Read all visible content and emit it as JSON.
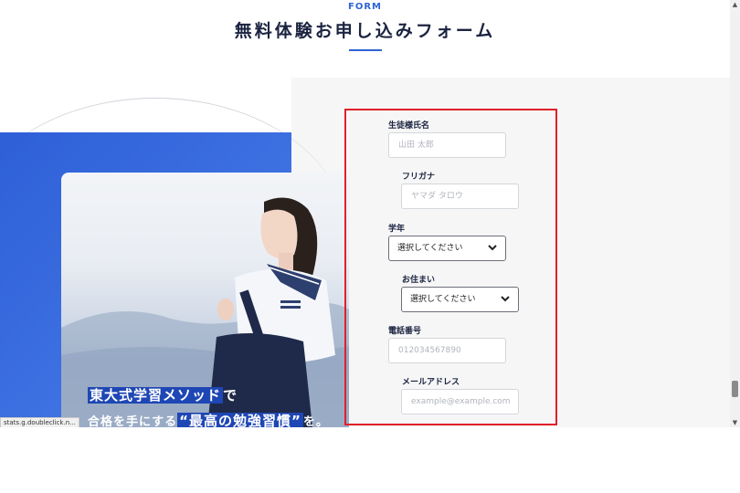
{
  "header": {
    "eyebrow": "FORM",
    "title": "無料体験お申し込みフォーム"
  },
  "hero": {
    "catch_highlight": "東大式学習メソッド",
    "catch_suffix": "で",
    "catch2_prefix": "合格を手にする",
    "catch2_highlight": "“最高の勉強習慣”",
    "catch2_suffix": "を。"
  },
  "form": {
    "student_name": {
      "label": "生徒様氏名",
      "placeholder": "山田 太郎"
    },
    "furigana": {
      "label": "フリガナ",
      "placeholder": "ヤマダ タロウ"
    },
    "grade": {
      "label": "学年",
      "value": "選択してください"
    },
    "residence": {
      "label": "お住まい",
      "value": "選択してください"
    },
    "phone": {
      "label": "電話番号",
      "placeholder": "012034567890"
    },
    "email": {
      "label": "メールアドレス",
      "placeholder": "example@example.com"
    }
  },
  "status_bar": {
    "text": "stats.g.doubleclick.n..."
  },
  "colors": {
    "accent": "#2f63d6",
    "highlight_box": "#e0202a",
    "title": "#1b2340"
  },
  "icons": {
    "select_arrow": "chevron-down-icon"
  }
}
